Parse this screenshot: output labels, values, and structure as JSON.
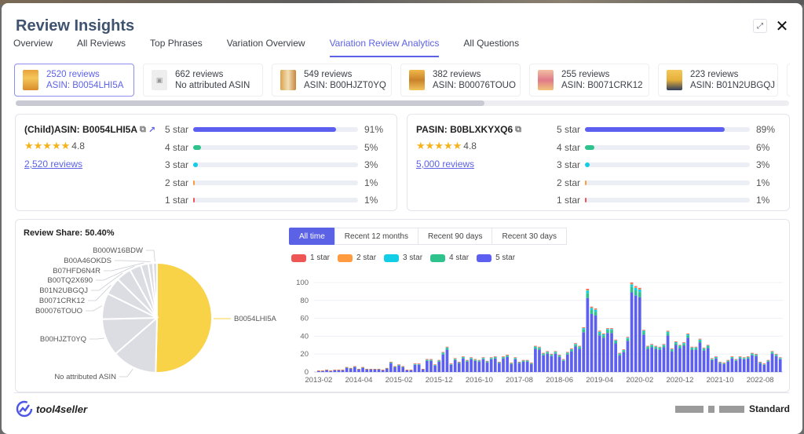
{
  "header": {
    "title": "Review Insights",
    "expand_icon": "expand-arrows-icon",
    "close_icon": "close-x-icon"
  },
  "tabs": [
    {
      "label": "Overview",
      "active": false
    },
    {
      "label": "All Reviews",
      "active": false
    },
    {
      "label": "Top Phrases",
      "active": false
    },
    {
      "label": "Variation Overview",
      "active": false
    },
    {
      "label": "Variation Review Analytics",
      "active": true
    },
    {
      "label": "All Questions",
      "active": false
    }
  ],
  "variation_cards": [
    {
      "reviews": "2520 reviews",
      "asin": "ASIN: B0054LHI5A",
      "selected": true,
      "thumb": "product-image"
    },
    {
      "reviews": "662 reviews",
      "asin": "No attributed ASIN",
      "selected": false,
      "thumb": "no-image"
    },
    {
      "reviews": "549 reviews",
      "asin": "ASIN: B00HJZT0YQ",
      "selected": false,
      "thumb": "product-image"
    },
    {
      "reviews": "382 reviews",
      "asin": "ASIN: B00076TOUO",
      "selected": false,
      "thumb": "product-image"
    },
    {
      "reviews": "255 reviews",
      "asin": "ASIN: B0071CRK12",
      "selected": false,
      "thumb": "product-image"
    },
    {
      "reviews": "223 reviews",
      "asin": "ASIN: B01N2UBGQJ",
      "selected": false,
      "thumb": "product-image"
    }
  ],
  "scroll_position": 0.6,
  "child_summary": {
    "title": "(Child)ASIN: B0054LHI5A",
    "rating": "4.8",
    "reviews_link": "2,520 reviews",
    "distribution": [
      {
        "label": "5 star",
        "pct": 91,
        "pct_text": "91%"
      },
      {
        "label": "4 star",
        "pct": 5,
        "pct_text": "5%"
      },
      {
        "label": "3 star",
        "pct": 3,
        "pct_text": "3%"
      },
      {
        "label": "2 star",
        "pct": 1,
        "pct_text": "1%"
      },
      {
        "label": "1 star",
        "pct": 1,
        "pct_text": "1%"
      }
    ]
  },
  "parent_summary": {
    "title": "PASIN: B0BLXKYXQ6",
    "rating": "4.8",
    "reviews_link": "5,000 reviews",
    "distribution": [
      {
        "label": "5 star",
        "pct": 89,
        "pct_text": "89%"
      },
      {
        "label": "4 star",
        "pct": 6,
        "pct_text": "6%"
      },
      {
        "label": "3 star",
        "pct": 3,
        "pct_text": "3%"
      },
      {
        "label": "2 star",
        "pct": 1,
        "pct_text": "1%"
      },
      {
        "label": "1 star",
        "pct": 1,
        "pct_text": "1%"
      }
    ]
  },
  "star_colors": {
    "5 star": "#5c5ff0",
    "4 star": "#2ec38c",
    "3 star": "#12cde6",
    "2 star": "#ff9a3e",
    "1 star": "#ee5555"
  },
  "review_share": {
    "label": "Review Share: 50.40%"
  },
  "time_ranges": [
    {
      "label": "All time",
      "active": true
    },
    {
      "label": "Recent 12 months",
      "active": false
    },
    {
      "label": "Recent 90 days",
      "active": false
    },
    {
      "label": "Recent 30 days",
      "active": false
    }
  ],
  "footer": {
    "brand": "tool4seller",
    "plan": "Standard"
  },
  "chart_data": [
    {
      "type": "pie",
      "title": "Review Share: 50.40%",
      "highlight_color": "#f8d247",
      "other_color": "#dcdce3",
      "slices": [
        {
          "label": "B0054LHI5A",
          "value": 2520,
          "highlight": true
        },
        {
          "label": "No attributed ASIN",
          "value": 662
        },
        {
          "label": "B00HJZT0YQ",
          "value": 549
        },
        {
          "label": "B00076TOUO",
          "value": 382
        },
        {
          "label": "B0071CRK12",
          "value": 255
        },
        {
          "label": "B01N2UBGQJ",
          "value": 223
        },
        {
          "label": "B00TQ2X690",
          "value": 170
        },
        {
          "label": "B07HFD6N4R",
          "value": 110
        },
        {
          "label": "B00A46OKDS",
          "value": 70
        },
        {
          "label": "B000W16BDW",
          "value": 59
        }
      ]
    },
    {
      "type": "bar",
      "stacked": true,
      "title": "",
      "xlabel": "",
      "ylabel": "",
      "ylim": [
        0,
        100
      ],
      "yticks": [
        0,
        20,
        40,
        60,
        80,
        100
      ],
      "grid": true,
      "legend": [
        "1 star",
        "2 star",
        "3 star",
        "4 star",
        "5 star"
      ],
      "legend_position": "top-left",
      "xtick_labels": [
        "2013-02",
        "2014-04",
        "2015-02",
        "2015-12",
        "2016-10",
        "2017-08",
        "2018-06",
        "2019-04",
        "2020-02",
        "2020-12",
        "2021-10",
        "2022-08"
      ],
      "x_start": "2013-02",
      "series_order": [
        "5 star",
        "4 star",
        "3 star",
        "2 star",
        "1 star"
      ],
      "totals": [
        1,
        1,
        2,
        1,
        2,
        2,
        2,
        5,
        4,
        6,
        3,
        5,
        3,
        3,
        3,
        3,
        2,
        4,
        11,
        6,
        8,
        6,
        2,
        2,
        9,
        9,
        3,
        14,
        14,
        8,
        13,
        22,
        28,
        9,
        15,
        11,
        17,
        13,
        16,
        14,
        13,
        16,
        12,
        16,
        17,
        11,
        17,
        19,
        10,
        16,
        11,
        13,
        13,
        10,
        29,
        28,
        21,
        23,
        20,
        23,
        19,
        14,
        22,
        26,
        32,
        29,
        50,
        93,
        73,
        71,
        46,
        43,
        49,
        49,
        36,
        21,
        25,
        39,
        100,
        96,
        94,
        47,
        29,
        31,
        29,
        28,
        31,
        46,
        26,
        34,
        30,
        33,
        43,
        28,
        28,
        37,
        27,
        30,
        15,
        17,
        11,
        10,
        13,
        17,
        14,
        17,
        16,
        17,
        21,
        20,
        11,
        9,
        13,
        23,
        20,
        16
      ]
    }
  ]
}
